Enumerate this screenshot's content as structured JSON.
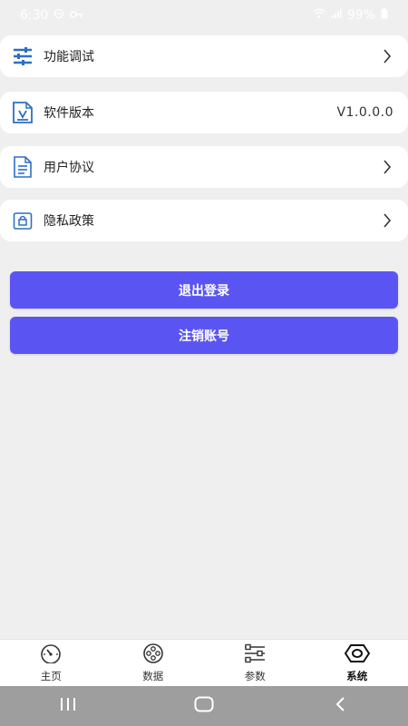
{
  "status_bar": {
    "time": "6:30",
    "battery": "99%"
  },
  "menu": {
    "items": [
      {
        "label": "功能调试",
        "icon": "sliders-icon",
        "action": "chevron-right-icon"
      },
      {
        "label": "软件版本",
        "icon": "document-version-icon",
        "value": "V1.0.0.0"
      },
      {
        "label": "用户协议",
        "icon": "document-lines-icon",
        "action": "chevron-right-icon"
      },
      {
        "label": "隐私政策",
        "icon": "lock-id-icon",
        "action": "chevron-right-icon"
      }
    ]
  },
  "actions": {
    "logout_label": "退出登录",
    "cancel_account_label": "注销账号"
  },
  "bottom_nav": {
    "tabs": [
      {
        "label": "主页",
        "icon": "speedometer-icon"
      },
      {
        "label": "数据",
        "icon": "film-reel-icon"
      },
      {
        "label": "参数",
        "icon": "parameters-icon"
      },
      {
        "label": "系统",
        "icon": "hex-nut-icon",
        "active": true
      }
    ]
  },
  "colors": {
    "accent": "#5a55f2",
    "icon_blue": "#2c6fc4",
    "background": "#efefef"
  }
}
